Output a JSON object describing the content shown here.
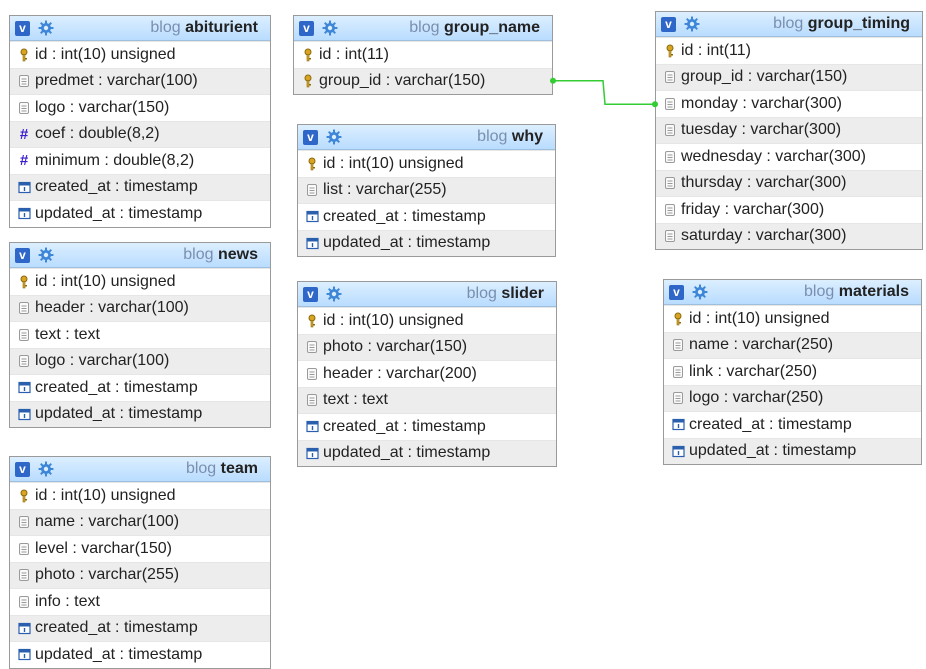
{
  "db": "blog",
  "colors": {
    "link": "#33cc33",
    "header_top": "#dcefff",
    "header_bottom": "#b9dcff",
    "hash": "#3d1fcf",
    "vbox": "#2f67c8"
  },
  "tables": [
    {
      "id": "abiturient",
      "name": "abiturient",
      "columns": [
        {
          "text": "id : int(10) unsigned",
          "icon": "key"
        },
        {
          "text": "predmet : varchar(100)",
          "icon": "text"
        },
        {
          "text": "logo : varchar(150)",
          "icon": "text"
        },
        {
          "text": "coef : double(8,2)",
          "icon": "hash"
        },
        {
          "text": "minimum : double(8,2)",
          "icon": "hash"
        },
        {
          "text": "created_at : timestamp",
          "icon": "clock"
        },
        {
          "text": "updated_at : timestamp",
          "icon": "clock"
        }
      ]
    },
    {
      "id": "news",
      "name": "news",
      "columns": [
        {
          "text": "id : int(10) unsigned",
          "icon": "key"
        },
        {
          "text": "header : varchar(100)",
          "icon": "text"
        },
        {
          "text": "text : text",
          "icon": "text"
        },
        {
          "text": "logo : varchar(100)",
          "icon": "text"
        },
        {
          "text": "created_at : timestamp",
          "icon": "clock"
        },
        {
          "text": "updated_at : timestamp",
          "icon": "clock"
        }
      ]
    },
    {
      "id": "team",
      "name": "team",
      "columns": [
        {
          "text": "id : int(10) unsigned",
          "icon": "key"
        },
        {
          "text": "name : varchar(100)",
          "icon": "text"
        },
        {
          "text": "level : varchar(150)",
          "icon": "text"
        },
        {
          "text": "photo : varchar(255)",
          "icon": "text"
        },
        {
          "text": "info : text",
          "icon": "text"
        },
        {
          "text": "created_at : timestamp",
          "icon": "clock"
        },
        {
          "text": "updated_at : timestamp",
          "icon": "clock"
        }
      ]
    },
    {
      "id": "group_name",
      "name": "group_name",
      "columns": [
        {
          "text": "id : int(11)",
          "icon": "key"
        },
        {
          "text": "group_id : varchar(150)",
          "icon": "key"
        }
      ]
    },
    {
      "id": "why",
      "name": "why",
      "columns": [
        {
          "text": "id : int(10) unsigned",
          "icon": "key"
        },
        {
          "text": "list : varchar(255)",
          "icon": "text"
        },
        {
          "text": "created_at : timestamp",
          "icon": "clock"
        },
        {
          "text": "updated_at : timestamp",
          "icon": "clock"
        }
      ]
    },
    {
      "id": "slider",
      "name": "slider",
      "columns": [
        {
          "text": "id : int(10) unsigned",
          "icon": "key"
        },
        {
          "text": "photo : varchar(150)",
          "icon": "text"
        },
        {
          "text": "header : varchar(200)",
          "icon": "text"
        },
        {
          "text": "text : text",
          "icon": "text"
        },
        {
          "text": "created_at : timestamp",
          "icon": "clock"
        },
        {
          "text": "updated_at : timestamp",
          "icon": "clock"
        }
      ]
    },
    {
      "id": "group_timing",
      "name": "group_timing",
      "columns": [
        {
          "text": "id : int(11)",
          "icon": "key"
        },
        {
          "text": "group_id : varchar(150)",
          "icon": "text"
        },
        {
          "text": "monday : varchar(300)",
          "icon": "text"
        },
        {
          "text": "tuesday : varchar(300)",
          "icon": "text"
        },
        {
          "text": "wednesday : varchar(300)",
          "icon": "text"
        },
        {
          "text": "thursday : varchar(300)",
          "icon": "text"
        },
        {
          "text": "friday : varchar(300)",
          "icon": "text"
        },
        {
          "text": "saturday : varchar(300)",
          "icon": "text"
        }
      ]
    },
    {
      "id": "materials",
      "name": "materials",
      "columns": [
        {
          "text": "id : int(10) unsigned",
          "icon": "key"
        },
        {
          "text": "name : varchar(250)",
          "icon": "text"
        },
        {
          "text": "link : varchar(250)",
          "icon": "text"
        },
        {
          "text": "logo : varchar(250)",
          "icon": "text"
        },
        {
          "text": "created_at : timestamp",
          "icon": "clock"
        },
        {
          "text": "updated_at : timestamp",
          "icon": "clock"
        }
      ]
    }
  ],
  "relations": [
    {
      "from": "group_name",
      "to": "group_timing"
    }
  ]
}
